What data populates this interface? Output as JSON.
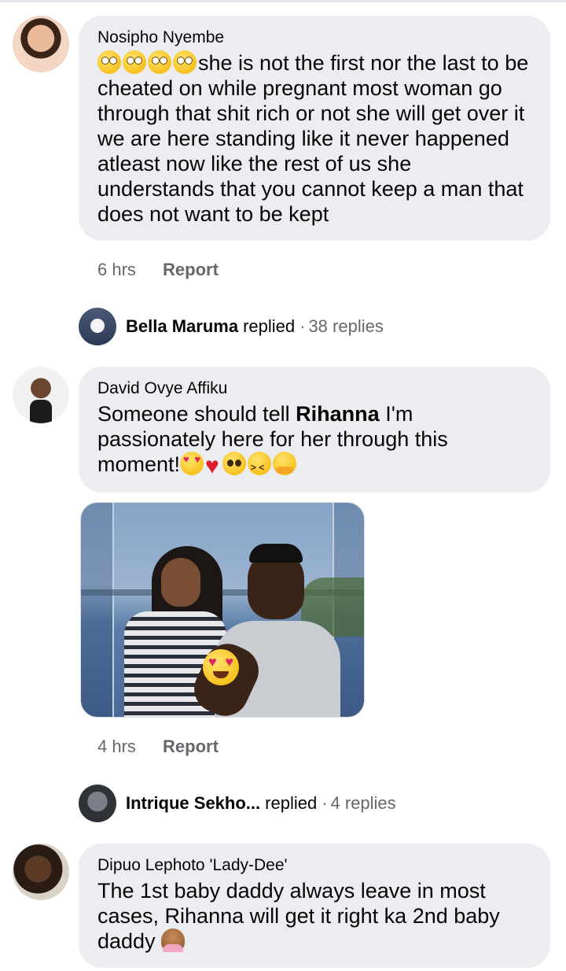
{
  "comments": [
    {
      "author": "Nosipho Nyembe",
      "text": "she is not the first nor the last to be cheated on while pregnant most woman go through that shit rich or not she will get over it we are here standing like it never happened atleast now like the rest of us she understands that you cannot keep a man that does not want to be kept",
      "leading_emojis": [
        "face-with-rolling-eyes",
        "face-with-rolling-eyes",
        "face-with-rolling-eyes",
        "face-with-rolling-eyes"
      ],
      "time": "6 hrs",
      "report_label": "Report",
      "reply_preview": {
        "name": "Bella Maruma",
        "verb": "replied",
        "separator": "·",
        "count": "38 replies"
      }
    },
    {
      "author": "David Ovye Affiku",
      "text_before": "Someone should tell ",
      "text_bold": "Rihanna",
      "text_after": " I'm passionately here for her through this moment!",
      "trailing_emojis": [
        "smiling-face-with-heart-eyes",
        "red-heart",
        "pleading-face",
        "weary-face",
        "hugging-face"
      ],
      "photo_sticker": "smiling-face-with-heart-eyes",
      "time": "4 hrs",
      "report_label": "Report",
      "reply_preview": {
        "name": "Intrique Sekho...",
        "verb": "replied",
        "separator": "·",
        "count": "4 replies"
      }
    },
    {
      "author": "Dipuo Lephoto 'Lady-Dee'",
      "text": "The 1st baby daddy always leave in most cases, Rihanna will get it right ka 2nd baby daddy",
      "trailing_emojis": [
        "person-shrugging"
      ]
    }
  ],
  "colors": {
    "bubble": "#ebedf0",
    "meta": "#65676b",
    "text": "#050505"
  }
}
